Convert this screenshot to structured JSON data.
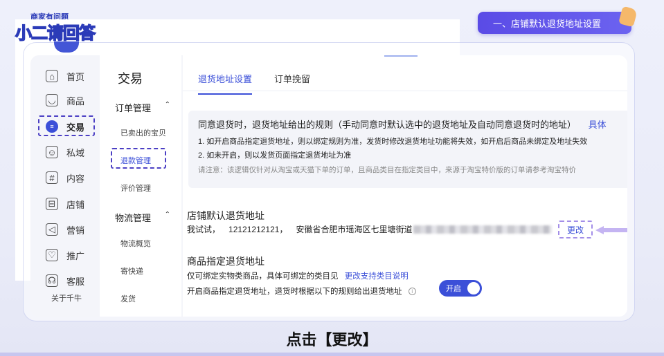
{
  "logo": {
    "top_text": "商家有问题",
    "main_text": "小二请回答"
  },
  "step_banner": "一、店铺默认退货地址设置",
  "nav": {
    "items": [
      {
        "label": "首页",
        "icon": "home-icon",
        "glyph": "⌂"
      },
      {
        "label": "商品",
        "icon": "goods-icon",
        "glyph": "◡"
      },
      {
        "label": "交易",
        "icon": "trade-icon",
        "glyph": "≡"
      },
      {
        "label": "私域",
        "icon": "private-domain-icon",
        "glyph": "☺"
      },
      {
        "label": "内容",
        "icon": "content-icon",
        "glyph": "#"
      },
      {
        "label": "店铺",
        "icon": "shop-icon",
        "glyph": "⊟"
      },
      {
        "label": "营销",
        "icon": "marketing-icon",
        "glyph": "◁"
      },
      {
        "label": "推广",
        "icon": "promotion-icon",
        "glyph": "♡"
      },
      {
        "label": "客服",
        "icon": "service-icon",
        "glyph": "☊"
      }
    ],
    "footer": "关于千牛"
  },
  "subnav": {
    "title": "交易",
    "group1": "订单管理",
    "group1_items": [
      "已卖出的宝贝",
      "退款管理",
      "评价管理"
    ],
    "group2": "物流管理",
    "group2_items": [
      "物流概览",
      "寄快递",
      "发货"
    ]
  },
  "tabs": [
    "退货地址设置",
    "订单挽留"
  ],
  "rules": {
    "heading": "同意退货时，退货地址给出的规则（手动同意时默认选中的退货地址及自动同意退货时的地址）",
    "heading_link": "具体",
    "line1": "1. 如开启商品指定退货地址，则以绑定规则为准，发货时修改退货地址功能将失效，如开启后商品未绑定及地址失效",
    "line2": "2. 如未开启，则以发货页面指定退货地址为准",
    "note": "请注意：该逻辑仅针对从淘宝或天猫下单的订单，且商品类目在指定类目中，来源于淘宝特价版的订单请参考淘宝特价"
  },
  "default_address": {
    "title": "店铺默认退货地址",
    "name": "我试试",
    "phone": "12121212121",
    "address": "安徽省合肥市瑶海区七里塘街道",
    "change_label": "更改"
  },
  "product_address": {
    "title": "商品指定退货地址",
    "desc": "仅可绑定实物类商品，具体可绑定的类目见",
    "desc_link": "更改支持类目说明",
    "toggle_desc": "开启商品指定退货地址，退货时根据以下的规则给出退货地址",
    "toggle_label": "开启"
  },
  "caption": "点击【更改】"
}
